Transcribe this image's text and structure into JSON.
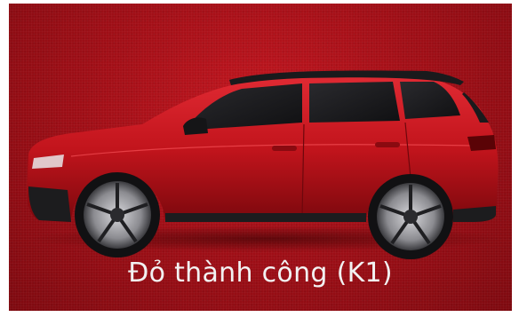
{
  "caption": "Đỏ thành công  (K1)",
  "colors": {
    "background": "#a30f17",
    "car_body": "#c2141c",
    "caption_text": "#f2f2f2"
  }
}
